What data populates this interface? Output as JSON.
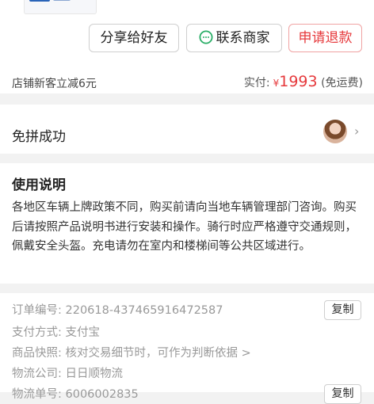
{
  "actions": {
    "share_label": "分享给好友",
    "contact_label": "联系商家",
    "refund_label": "申请退款"
  },
  "price": {
    "promo_text": "店铺新客立减6元",
    "paid_label": "实付:",
    "currency": "¥",
    "amount": "1993",
    "shipping": "(免运费)"
  },
  "group_status": {
    "title": "免拼成功"
  },
  "notes": {
    "title": "使用说明",
    "body": "各地区车辆上牌政策不同，购买前请向当地车辆管理部门咨询。购买后请按照产品说明书进行安装和操作。骑行时应严格遵守交通规则，佩戴安全头盔。充电请勿在室内和楼梯间等公共区域进行。"
  },
  "order_info": {
    "order_no_label": "订单编号:",
    "order_no": "220618-437465916472587",
    "copy_label": "复制",
    "payment_label": "支付方式:",
    "payment": "支付宝",
    "snapshot_label": "商品快照:",
    "snapshot": "核对交易细节时，可作为判断依据 >",
    "logistics_label": "物流公司:",
    "logistics": "日日顺物流",
    "tracking_label": "物流单号:",
    "tracking": "6006002835"
  },
  "colors": {
    "accent_red": "#e6393c",
    "wechat_green": "#2aae67"
  }
}
